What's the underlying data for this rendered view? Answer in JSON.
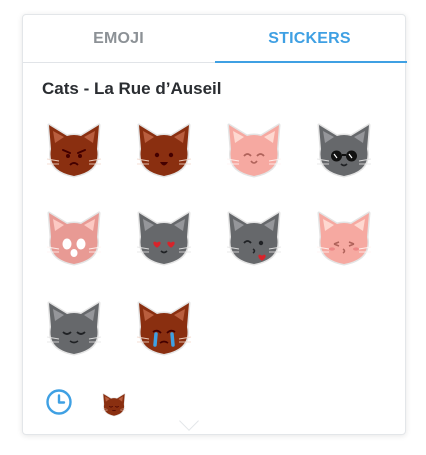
{
  "tabs": [
    {
      "label": "EMOJI",
      "active": false
    },
    {
      "label": "STICKERS",
      "active": true
    }
  ],
  "sticker_set": {
    "title": "Cats - La Rue d’Auseil",
    "stickers": [
      {
        "name": "brown-cat-angry-sticker",
        "color": "#8a2f10",
        "expression": "angry"
      },
      {
        "name": "brown-cat-happy-sticker",
        "color": "#8a2f10",
        "expression": "happy"
      },
      {
        "name": "pink-cat-smile-sticker",
        "color": "#f6a9a1",
        "expression": "smile"
      },
      {
        "name": "gray-cat-sunglasses-sticker",
        "color": "#66686b",
        "expression": "sunglasses"
      },
      {
        "name": "pink-cat-scared-sticker",
        "color": "#e89a94",
        "expression": "scared"
      },
      {
        "name": "gray-cat-heart-eyes-sticker",
        "color": "#66686b",
        "expression": "heart-eyes"
      },
      {
        "name": "gray-cat-kiss-sticker",
        "color": "#66686b",
        "expression": "kiss"
      },
      {
        "name": "pink-cat-blush-sticker",
        "color": "#f6a9a1",
        "expression": "blush"
      },
      {
        "name": "gray-cat-sleepy-sticker",
        "color": "#66686b",
        "expression": "sleepy"
      },
      {
        "name": "brown-cat-crying-sticker",
        "color": "#8a2f10",
        "expression": "crying"
      }
    ]
  },
  "footer": {
    "recent_icon": "clock-icon",
    "set_icon": "brown-cat-set-icon"
  },
  "colors": {
    "accent": "#3fa0e3",
    "inactive_tab": "#8c9196",
    "title": "#2a2d31"
  }
}
